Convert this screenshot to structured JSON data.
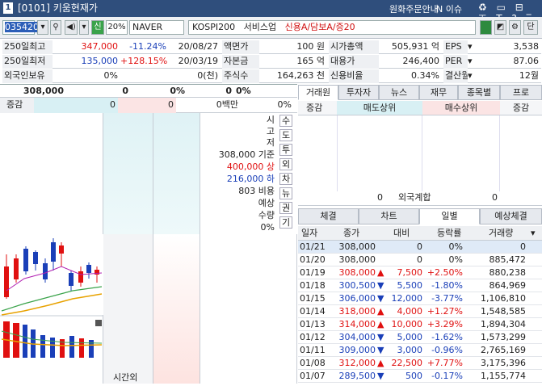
{
  "window": {
    "number": "1",
    "title": "[0101] 키움현재가",
    "notice": "원화주문안내",
    "issue": "N 이슈",
    "icons": "♻ ▭ ⊟ ⊤ T ? ‾"
  },
  "toolbar": {
    "code": "035420",
    "credit_badge": "신",
    "margin": "20%",
    "name": "NAVER",
    "market": "KOSPI200",
    "sector": "서비스업",
    "credit_info": "신용A/담보A/증20",
    "single": "단"
  },
  "stats": [
    {
      "l1": "250일최고",
      "v1": "347,000",
      "c1": "red",
      "p1": "-11.24%",
      "pc1": "blue",
      "d1": "20/08/27",
      "l2": "액면가",
      "v2": "100 원",
      "l3": "시가총액",
      "v3": "505,931 억",
      "l4": "EPS",
      "v4": "3,538"
    },
    {
      "l1": "250일최저",
      "v1": "135,000",
      "c1": "blue",
      "p1": "+128.15%",
      "pc1": "red",
      "d1": "20/03/19",
      "l2": "자본금",
      "v2": "165 억",
      "l3": "대용가",
      "v3": "246,400",
      "l4": "PER",
      "v4": "87.06"
    },
    {
      "l1": "외국인보유",
      "v1": "0%",
      "c1": "",
      "p1": "",
      "pc1": "",
      "d1": "0(천)",
      "l2": "주식수",
      "v2": "164,263 천",
      "l3": "신용비율",
      "v3": "0.34%",
      "l4": "결산월",
      "v4": "12월"
    }
  ],
  "summary": {
    "price": "308,000",
    "change": "0",
    "rate": "0%",
    "vol": "0",
    "volrate": "0%"
  },
  "summary2": {
    "label": "증감",
    "a": "0",
    "b": "0",
    "c": "0백만",
    "d": "0%"
  },
  "hoga": {
    "vlabel": [
      "시",
      "고",
      "저"
    ],
    "base_label": "기준",
    "base_val": "308,000",
    "upper_label": "상",
    "upper_val": "400,000",
    "lower_label": "하",
    "lower_val": "216,000",
    "cost_label": "비용",
    "cost_val": "803",
    "expect_label": "예상",
    "qty_label": "수량",
    "qty_val": "0%",
    "side_tabs": [
      "수",
      "도",
      "투",
      "외",
      "차",
      "뉴",
      "권",
      "기"
    ],
    "time_label": "시간외"
  },
  "tabs1": [
    "거래원",
    "투자자",
    "뉴스",
    "재무",
    "종목별",
    "프로"
  ],
  "trade_head": {
    "c1": "증감",
    "c2": "매도상위",
    "c3": "매수상위",
    "c4": "증감"
  },
  "foreign": {
    "left": "0",
    "label": "외국계합",
    "right": "0"
  },
  "tabs2": [
    "체결",
    "차트",
    "일별",
    "예상체결"
  ],
  "daily_head": {
    "date": "일자",
    "close": "종가",
    "diff": "대비",
    "rate": "등락률",
    "vol": "거래량"
  },
  "daily": [
    {
      "date": "01/21",
      "close": "308,000",
      "arrow": "",
      "diff": "0",
      "rate": "0%",
      "vol": "0",
      "c": ""
    },
    {
      "date": "01/20",
      "close": "308,000",
      "arrow": "",
      "diff": "0",
      "rate": "0%",
      "vol": "885,472",
      "c": ""
    },
    {
      "date": "01/19",
      "close": "308,000",
      "arrow": "▲",
      "diff": "7,500",
      "rate": "+2.50%",
      "vol": "880,238",
      "c": "red"
    },
    {
      "date": "01/18",
      "close": "300,500",
      "arrow": "▼",
      "diff": "5,500",
      "rate": "-1.80%",
      "vol": "864,969",
      "c": "blue"
    },
    {
      "date": "01/15",
      "close": "306,000",
      "arrow": "▼",
      "diff": "12,000",
      "rate": "-3.77%",
      "vol": "1,106,810",
      "c": "blue"
    },
    {
      "date": "01/14",
      "close": "318,000",
      "arrow": "▲",
      "diff": "4,000",
      "rate": "+1.27%",
      "vol": "1,548,585",
      "c": "red"
    },
    {
      "date": "01/13",
      "close": "314,000",
      "arrow": "▲",
      "diff": "10,000",
      "rate": "+3.29%",
      "vol": "1,894,304",
      "c": "red"
    },
    {
      "date": "01/12",
      "close": "304,000",
      "arrow": "▼",
      "diff": "5,000",
      "rate": "-1.62%",
      "vol": "1,573,299",
      "c": "blue"
    },
    {
      "date": "01/11",
      "close": "309,000",
      "arrow": "▼",
      "diff": "3,000",
      "rate": "-0.96%",
      "vol": "2,765,169",
      "c": "blue"
    },
    {
      "date": "01/08",
      "close": "312,000",
      "arrow": "▲",
      "diff": "22,500",
      "rate": "+7.77%",
      "vol": "3,175,396",
      "c": "red"
    },
    {
      "date": "01/07",
      "close": "289,500",
      "arrow": "▼",
      "diff": "500",
      "rate": "-0.17%",
      "vol": "1,155,774",
      "c": "blue"
    }
  ],
  "colors": {
    "up": "#e01010",
    "down": "#1a3fb8",
    "title": "#2f4e7c"
  }
}
